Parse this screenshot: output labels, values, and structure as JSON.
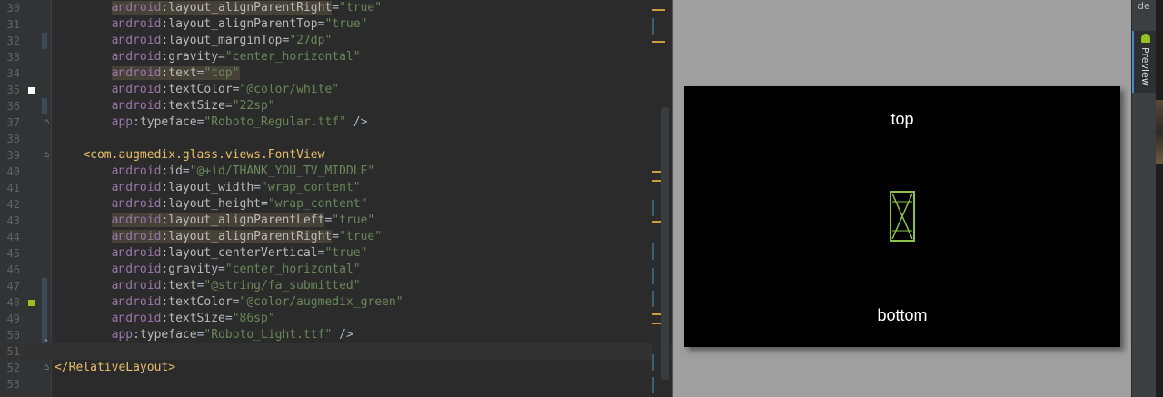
{
  "editor": {
    "lines": [
      {
        "no": "30",
        "parts": [
          [
            "",
            "        "
          ],
          [
            "hl ns",
            "android"
          ],
          [
            "hl attr",
            ":layout_alignParentRight"
          ],
          [
            "",
            "="
          ],
          [
            "val",
            "\"true\""
          ]
        ]
      },
      {
        "no": "31",
        "parts": [
          [
            "",
            "        "
          ],
          [
            "ns",
            "android"
          ],
          [
            "attr",
            ":layout_alignParentTop"
          ],
          [
            "",
            "="
          ],
          [
            "val",
            "\"true\""
          ]
        ]
      },
      {
        "no": "32",
        "parts": [
          [
            "",
            "        "
          ],
          [
            "ns",
            "android"
          ],
          [
            "attr",
            ":layout_marginTop"
          ],
          [
            "",
            "="
          ],
          [
            "val",
            "\"27dp\""
          ]
        ]
      },
      {
        "no": "33",
        "parts": [
          [
            "",
            "        "
          ],
          [
            "ns",
            "android"
          ],
          [
            "attr",
            ":gravity"
          ],
          [
            "",
            "="
          ],
          [
            "val",
            "\"center_horizontal\""
          ]
        ]
      },
      {
        "no": "34",
        "parts": [
          [
            "",
            "        "
          ],
          [
            "hl ns",
            "android"
          ],
          [
            "hl attr",
            ":text"
          ],
          [
            "hl",
            "="
          ],
          [
            "hl val",
            "\"top\""
          ]
        ]
      },
      {
        "no": "35",
        "parts": [
          [
            "",
            "        "
          ],
          [
            "ns",
            "android"
          ],
          [
            "attr",
            ":textColor"
          ],
          [
            "",
            "="
          ],
          [
            "val",
            "\"@color/white\""
          ]
        ]
      },
      {
        "no": "36",
        "parts": [
          [
            "",
            "        "
          ],
          [
            "ns",
            "android"
          ],
          [
            "attr",
            ":textSize"
          ],
          [
            "",
            "="
          ],
          [
            "val",
            "\"22sp\""
          ]
        ]
      },
      {
        "no": "37",
        "parts": [
          [
            "",
            "        "
          ],
          [
            "ns",
            "app"
          ],
          [
            "attr",
            ":typeface"
          ],
          [
            "",
            "="
          ],
          [
            "val",
            "\"Roboto_Regular.ttf\""
          ],
          [
            "",
            " />"
          ]
        ]
      },
      {
        "no": "38",
        "parts": []
      },
      {
        "no": "39",
        "parts": [
          [
            "",
            "    "
          ],
          [
            "tag",
            "<com.augmedix.glass.views.FontView"
          ]
        ]
      },
      {
        "no": "40",
        "parts": [
          [
            "",
            "        "
          ],
          [
            "ns",
            "android"
          ],
          [
            "attr",
            ":id"
          ],
          [
            "",
            "="
          ],
          [
            "val",
            "\"@+id/THANK_YOU_TV_MIDDLE\""
          ]
        ]
      },
      {
        "no": "41",
        "parts": [
          [
            "",
            "        "
          ],
          [
            "ns",
            "android"
          ],
          [
            "attr",
            ":layout_width"
          ],
          [
            "",
            "="
          ],
          [
            "val",
            "\"wrap_content\""
          ]
        ]
      },
      {
        "no": "42",
        "parts": [
          [
            "",
            "        "
          ],
          [
            "ns",
            "android"
          ],
          [
            "attr",
            ":layout_height"
          ],
          [
            "",
            "="
          ],
          [
            "val",
            "\"wrap_content\""
          ]
        ]
      },
      {
        "no": "43",
        "parts": [
          [
            "",
            "        "
          ],
          [
            "hl ns",
            "android"
          ],
          [
            "hl attr",
            ":layout_alignParentLeft"
          ],
          [
            "",
            "="
          ],
          [
            "val",
            "\"true\""
          ]
        ]
      },
      {
        "no": "44",
        "parts": [
          [
            "",
            "        "
          ],
          [
            "hl ns",
            "android"
          ],
          [
            "hl attr",
            ":layout_alignParentRight"
          ],
          [
            "",
            "="
          ],
          [
            "val",
            "\"true\""
          ]
        ]
      },
      {
        "no": "45",
        "parts": [
          [
            "",
            "        "
          ],
          [
            "ns",
            "android"
          ],
          [
            "attr",
            ":layout_centerVertical"
          ],
          [
            "",
            "="
          ],
          [
            "val",
            "\"true\""
          ]
        ]
      },
      {
        "no": "46",
        "parts": [
          [
            "",
            "        "
          ],
          [
            "ns",
            "android"
          ],
          [
            "attr",
            ":gravity"
          ],
          [
            "",
            "="
          ],
          [
            "val",
            "\"center_horizontal\""
          ]
        ]
      },
      {
        "no": "47",
        "parts": [
          [
            "",
            "        "
          ],
          [
            "ns",
            "android"
          ],
          [
            "attr",
            ":text"
          ],
          [
            "",
            "="
          ],
          [
            "val",
            "\"@string/fa_submitted\""
          ]
        ]
      },
      {
        "no": "48",
        "parts": [
          [
            "",
            "        "
          ],
          [
            "ns",
            "android"
          ],
          [
            "attr",
            ":textColor"
          ],
          [
            "",
            "="
          ],
          [
            "val",
            "\"@color/augmedix_green\""
          ]
        ]
      },
      {
        "no": "49",
        "parts": [
          [
            "",
            "        "
          ],
          [
            "ns",
            "android"
          ],
          [
            "attr",
            ":textSize"
          ],
          [
            "",
            "="
          ],
          [
            "val",
            "\"86sp\""
          ]
        ]
      },
      {
        "no": "50",
        "parts": [
          [
            "",
            "        "
          ],
          [
            "ns",
            "app"
          ],
          [
            "attr",
            ":typeface"
          ],
          [
            "",
            "="
          ],
          [
            "val",
            "\"Roboto_Light.ttf\""
          ],
          [
            "",
            " />"
          ]
        ]
      },
      {
        "no": "51",
        "parts": []
      },
      {
        "no": "52",
        "parts": [
          [
            "tag",
            "</RelativeLayout>"
          ]
        ]
      },
      {
        "no": "53",
        "parts": []
      }
    ]
  },
  "preview": {
    "top_text": "top",
    "bottom_text": "bottom",
    "icon_color": "#8bc34a"
  },
  "side_panel": {
    "tab_fragment": "de",
    "preview_tab": "Preview"
  },
  "colors": {
    "accent_green": "#97c024",
    "marker_orange": "#c99e3b"
  }
}
